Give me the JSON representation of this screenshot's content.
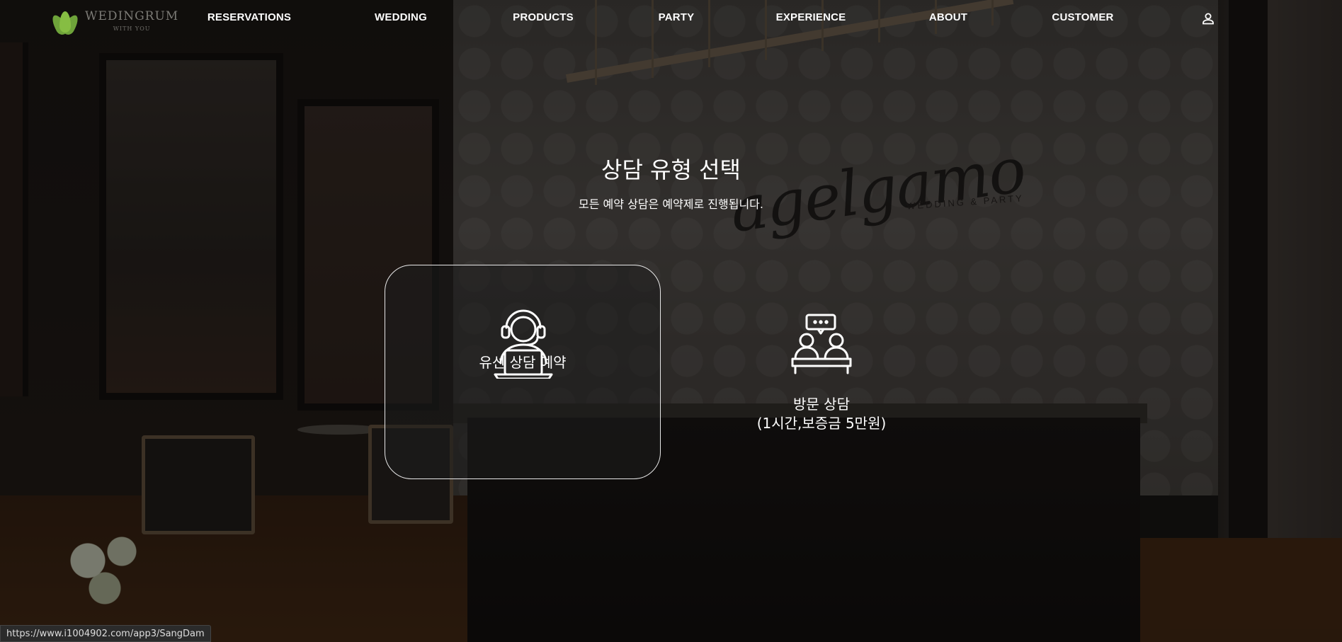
{
  "logo": {
    "name": "WEDINGRUM",
    "tagline": "WITH YOU"
  },
  "nav": [
    {
      "label": "RESERVATIONS"
    },
    {
      "label": "WEDDING"
    },
    {
      "label": "PRODUCTS"
    },
    {
      "label": "PARTY"
    },
    {
      "label": "EXPERIENCE"
    },
    {
      "label": "ABOUT"
    },
    {
      "label": "CUSTOMER"
    }
  ],
  "header": {
    "user_icon": "user-icon"
  },
  "main": {
    "title": "상담 유형 선택",
    "subtitle": "모든 예약 상담은 예약제로 진행됩니다."
  },
  "options": [
    {
      "label": "유선 상담 예약",
      "icon": "headset-agent-icon",
      "selected": true
    },
    {
      "label_line1": "방문 상담",
      "label_line2": "(1시간,보증금 5만원)",
      "icon": "meeting-consult-icon",
      "selected": false
    }
  ],
  "background_sign": {
    "script": "agelgamo",
    "sub": "WEDDING & PARTY"
  },
  "status_bar": {
    "url": "https://www.i1004902.com/app3/SangDam"
  },
  "colors": {
    "card_border": "#e8e8e8",
    "logo_leaf": "#6ea33a",
    "text": "#ffffff"
  }
}
